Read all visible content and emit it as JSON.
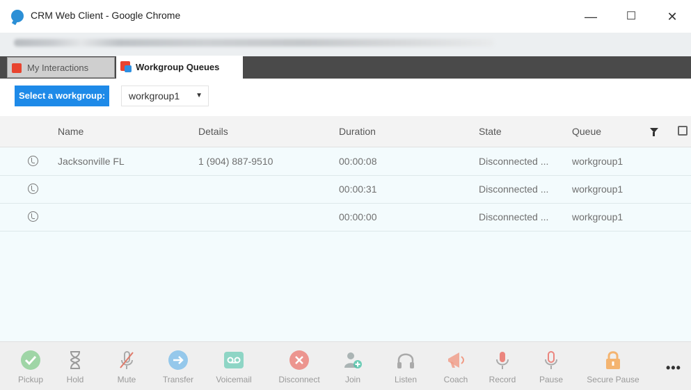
{
  "window": {
    "title": "CRM Web Client - Google Chrome",
    "minimize": "—",
    "maximize": "☐",
    "close": "✕"
  },
  "tabs": [
    {
      "label": "My Interactions",
      "active": false
    },
    {
      "label": "Workgroup Queues",
      "active": true
    }
  ],
  "workgroup": {
    "label": "Select a workgroup:",
    "selected": "workgroup1",
    "caret": "▼"
  },
  "table": {
    "columns": [
      "Name",
      "Details",
      "Duration",
      "State",
      "Queue"
    ],
    "rows": [
      {
        "name": "Jacksonville FL",
        "details": "1 (904) 887-9510",
        "duration": "00:00:08",
        "state": "Disconnected ...",
        "queue": "workgroup1"
      },
      {
        "name": "",
        "details": "",
        "duration": "00:00:31",
        "state": "Disconnected ...",
        "queue": "workgroup1"
      },
      {
        "name": "",
        "details": "",
        "duration": "00:00:00",
        "state": "Disconnected ...",
        "queue": "workgroup1"
      }
    ]
  },
  "toolbar": {
    "buttons": [
      {
        "label": "Pickup",
        "icon": "check-circle-icon",
        "color": "#5cc06a"
      },
      {
        "label": "Hold",
        "icon": "hourglass-icon",
        "color": "#8a8a8a"
      },
      {
        "label": "Mute",
        "icon": "mic-off-icon",
        "color": "#e07a6a"
      },
      {
        "label": "Transfer",
        "icon": "arrow-right-circle-icon",
        "color": "#4aa8e8"
      },
      {
        "label": "Voicemail",
        "icon": "voicemail-icon",
        "color": "#4cc3a8"
      },
      {
        "label": "Disconnect",
        "icon": "x-circle-icon",
        "color": "#e9584e"
      },
      {
        "label": "Join",
        "icon": "user-add-icon",
        "color": "#6c8a8a"
      },
      {
        "label": "Listen",
        "icon": "headphones-icon",
        "color": "#8a8a8a"
      },
      {
        "label": "Coach",
        "icon": "megaphone-icon",
        "color": "#f09a84"
      },
      {
        "label": "Record",
        "icon": "mic-icon",
        "color": "#e9584e"
      },
      {
        "label": "Pause",
        "icon": "mic-pause-icon",
        "color": "#e9584e"
      },
      {
        "label": "Secure Pause",
        "icon": "lock-icon",
        "color": "#f5a550"
      }
    ],
    "more": "•••"
  }
}
